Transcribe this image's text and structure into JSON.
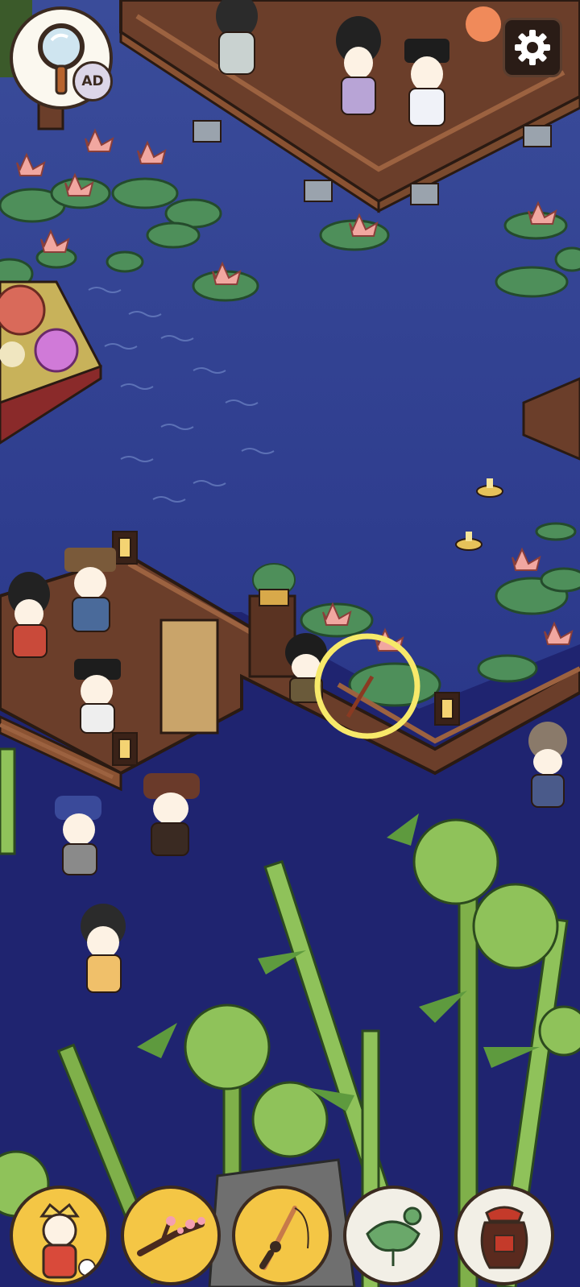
{
  "hud": {
    "hint_button": {
      "icon": "magnifier-icon",
      "badge": "AD"
    },
    "settings_button": {
      "icon": "gear-icon"
    }
  },
  "item_bar": [
    {
      "name": "character-portrait",
      "icon": "character-icon",
      "found": true
    },
    {
      "name": "plum-branch",
      "icon": "plum-branch-icon",
      "found": true
    },
    {
      "name": "fishing-rod",
      "icon": "fishing-rod-icon",
      "found": true
    },
    {
      "name": "lotus-leaf",
      "icon": "lotus-leaf-icon",
      "found": false
    },
    {
      "name": "wine-jar",
      "icon": "wine-jar-icon",
      "found": false
    }
  ],
  "highlight": {
    "target": "fishing-rod"
  },
  "colors": {
    "water": "#2f3f8f",
    "water_dark": "#22287a",
    "deck": "#6b3e2a",
    "lotus_pad": "#4e8f5a",
    "lotus_flower": "#f1a7a0",
    "bamboo": "#8fc25a",
    "highlight": "#f7e96a"
  }
}
